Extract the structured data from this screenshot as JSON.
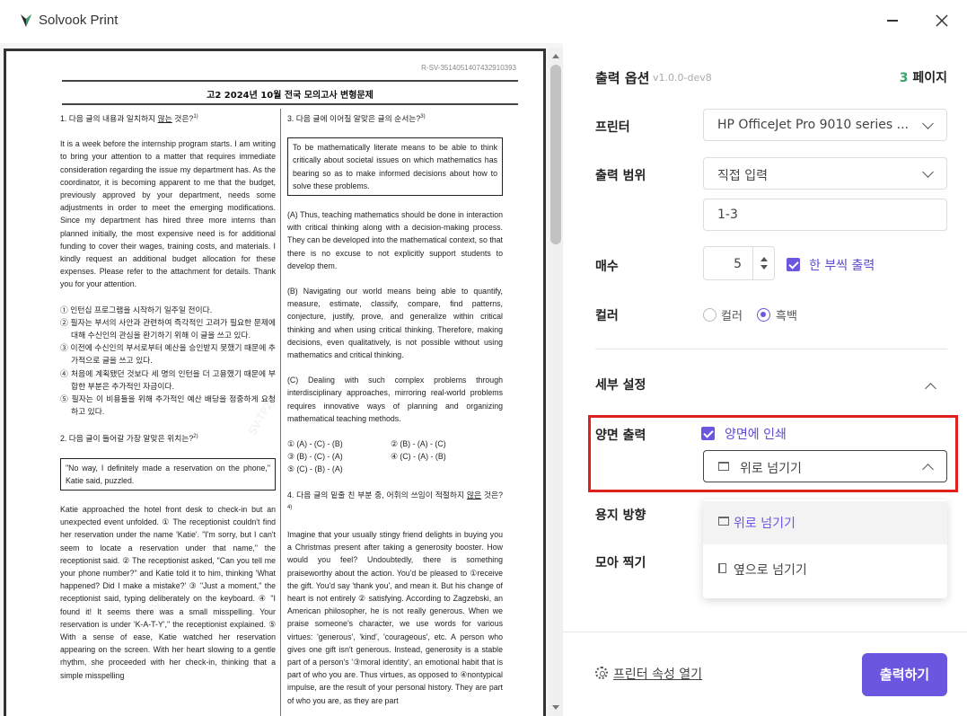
{
  "window": {
    "title": "Solvook Print",
    "icons": [
      "solvook-logo-icon",
      "minimize-icon",
      "close-icon"
    ]
  },
  "document": {
    "code": "R-SV-3514051407432910393",
    "title": "고2 2024년 10월 전국 모의고사 변형문제",
    "watermark": "SV-TP2J",
    "left_column": {
      "q1_prefix": "1. 다음 글의 내용과 일치하지 ",
      "q1_underline": "않는",
      "q1_suffix": " 것은?",
      "q1_footnote": "1)",
      "q1_body": "It is a week before the internship program starts. I am writing to bring your attention to a matter that requires immediate consideration regarding the issue my department has. As the coordinator, it is becoming apparent to me that the budget, previously approved by your department, needs some adjustments in order to meet the emerging modifications. Since my department has hired three more interns than planned initially, the most expensive need is for additional funding to cover their wages, training costs, and materials. I kindly request an additional budget allocation for these expenses. Please refer to the attachment for details. Thank you for your attention.",
      "q1_options": [
        "① 인턴십 프로그램을 시작하기 일주일 전이다.",
        "② 필자는 부서의 사안과 관련하여 즉각적인 고려가 필요한 문제에 대해 수신인의 관심을 환기하기 위해 이 글을 쓰고 있다.",
        "③ 이전에 수신인의 부서로부터 예산을 승인받지 못했기 때문에 추가적으로 글을 쓰고 있다.",
        "④ 처음에 계획됐던 것보다 세 명의 인턴을 더 고용했기 때문에 부합한 부분은 추가적인 자금이다.",
        "⑤ 필자는 이 비용들을 위해 추가적인 예산 배당을 정중하게 요청하고 있다."
      ],
      "q2_question": "2. 다음 글이 들어갈 가장 알맞은 위치는?",
      "q2_footnote": "2)",
      "q2_box": "\"No way, I definitely made a reservation on the phone,\" Katie said, puzzled.",
      "q2_body": "Katie approached the hotel front desk to check-in but an unexpected event unfolded. ① The receptionist couldn't find her reservation under the name 'Katie'. \"I'm sorry, but I can't seem to locate a reservation under that name,\" the receptionist said. ② The receptionist asked, \"Can you tell me your phone number?\" and Katie told it to him, thinking 'What happened? Did I make a mistake?' ③ \"Just a moment,\" the receptionist said, typing deliberately on the keyboard. ④ \"I found it! It seems there was a small misspelling. Your reservation is under 'K-A-T-Y',\" the receptionist explained. ⑤ With a sense of ease, Katie watched her reservation appearing on the screen. With her heart slowing to a gentle rhythm, she proceeded with her check-in, thinking that a simple misspelling"
    },
    "right_column": {
      "q3_question": "3. 다음 글에 이어질 알맞은 글의 순서는?",
      "q3_footnote": "3)",
      "q3_box": "To be mathematically literate means to be able to think critically about societal issues on which mathematics has bearing so as to make informed decisions about how to solve these problems.",
      "q3_a": "(A) Thus, teaching mathematics should be done in interaction with critical thinking along with a decision-making process. They can be developed into the mathematical context, so that there is no excuse to not explicitly support students to develop them.",
      "q3_b": "(B) Navigating our world means being able to quantify, measure, estimate, classify, compare, find patterns, conjecture, justify, prove, and generalize within critical thinking and when using critical thinking. Therefore, making decisions, even qualitatively, is not possible without using mathematics and critical thinking.",
      "q3_c": "(C) Dealing with such complex problems through interdisciplinary approaches, mirroring real-world problems requires innovative ways of planning and organizing mathematical teaching methods.",
      "q3_choices": [
        "① (A) - (C) - (B)",
        "② (B) - (A) - (C)",
        "③ (B) - (C) - (A)",
        "④ (C) - (A) - (B)",
        "⑤ (C) - (B) - (A)"
      ],
      "q4_question_a": "4. 다음 글의 밑줄 친 부분 중, 어휘의 쓰임이 적절하지 ",
      "q4_question_u": "않은",
      "q4_question_b": " 것은?",
      "q4_footnote": "4)",
      "q4_body": "Imagine that your usually stingy friend delights in buying you a Christmas present after taking a generosity booster. How would you feel? Undoubtedly, there is something praiseworthy about the action. You'd be pleased to ①receive the gift. You'd say 'thank you', and mean it. But his change of heart is not entirely ② satisfying. According to Zagzebski, an American philosopher, he is not really generous. When we praise someone's character, we use words for various virtues: 'generous', 'kind', 'courageous', etc. A person who gives one gift isn't generous. Instead, generosity is a stable part of a person's '③moral identity', an emotional habit that is part of who you are. Thus virtues, as opposed to ④nontypical impulse, are the result of your personal history. They are part of who you are, as they are part"
    }
  },
  "panel": {
    "title": "출력 옵션",
    "version": "v1.0.0-dev8",
    "page_count": "3",
    "page_unit": "페이지",
    "printer_label": "프린터",
    "printer_value": "HP OfficeJet Pro 9010 series ...",
    "range_label": "출력 범위",
    "range_value": "직접 입력",
    "range_input": "1-3",
    "copies_label": "매수",
    "copies_value": "5",
    "collate_label": "한 부씩 출력",
    "color_label": "컬러",
    "color_option_color": "컬러",
    "color_option_bw": "흑백",
    "color_selected": "흑백",
    "detail_label": "세부 설정",
    "duplex_label": "양면 출력",
    "duplex_checkbox": "양면에 인쇄",
    "flip_value": "위로 넘기기",
    "flip_options": [
      "위로 넘기기",
      "옆으로 넘기기"
    ],
    "orientation_label": "용지 방향",
    "nup_label": "모아 찍기",
    "printer_props": "프린터 속성 열기",
    "print_button": "출력하기",
    "colors": {
      "accent": "#6b56e0",
      "highlight": "#e0201c",
      "page_count": "#35a56a"
    }
  }
}
